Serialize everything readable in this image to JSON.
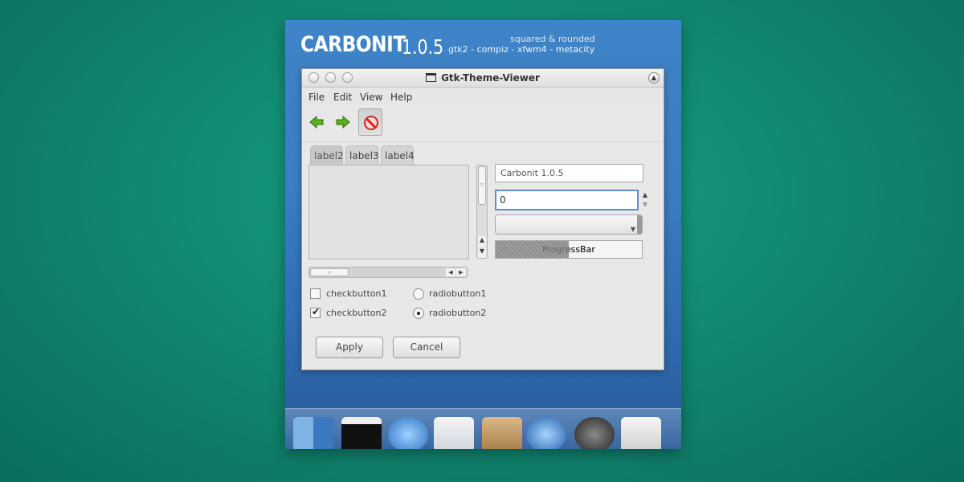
{
  "header": {
    "brand": "CARBONIT",
    "version": "1.0.5",
    "tagline": "squared & rounded",
    "platforms": "gtk2 - compiz - xfwm4 - metacity"
  },
  "window": {
    "title": "Gtk-Theme-Viewer",
    "menu": [
      "File",
      "Edit",
      "View",
      "Help"
    ],
    "toolbar": [
      "back-arrow-icon",
      "forward-arrow-icon",
      "stop-icon"
    ],
    "tabs": [
      "label2",
      "label3",
      "label4"
    ],
    "entry_value": "Carbonit 1.0.5",
    "spin_value": "0",
    "combo_value": "",
    "progress": {
      "label": "ProgressBar",
      "fraction": 0.5
    },
    "checks": [
      {
        "label": "checkbutton1",
        "checked": false
      },
      {
        "label": "checkbutton2",
        "checked": true
      }
    ],
    "radios": [
      {
        "label": "radiobutton1",
        "checked": false
      },
      {
        "label": "radiobutton2",
        "checked": true
      }
    ],
    "buttons": {
      "apply": "Apply",
      "cancel": "Cancel"
    }
  },
  "dock": [
    "finder-icon",
    "terminal-icon",
    "safari-icon",
    "mail-icon",
    "package-icon",
    "quicktime-icon",
    "itunes-icon",
    "utility-icon"
  ],
  "colors": {
    "background": "#118a72",
    "panel": "#3a7dc1",
    "window": "#e8e8e8",
    "focus": "#5b8fc9",
    "stop": "#dd2222",
    "arrow": "#5fb01e"
  }
}
